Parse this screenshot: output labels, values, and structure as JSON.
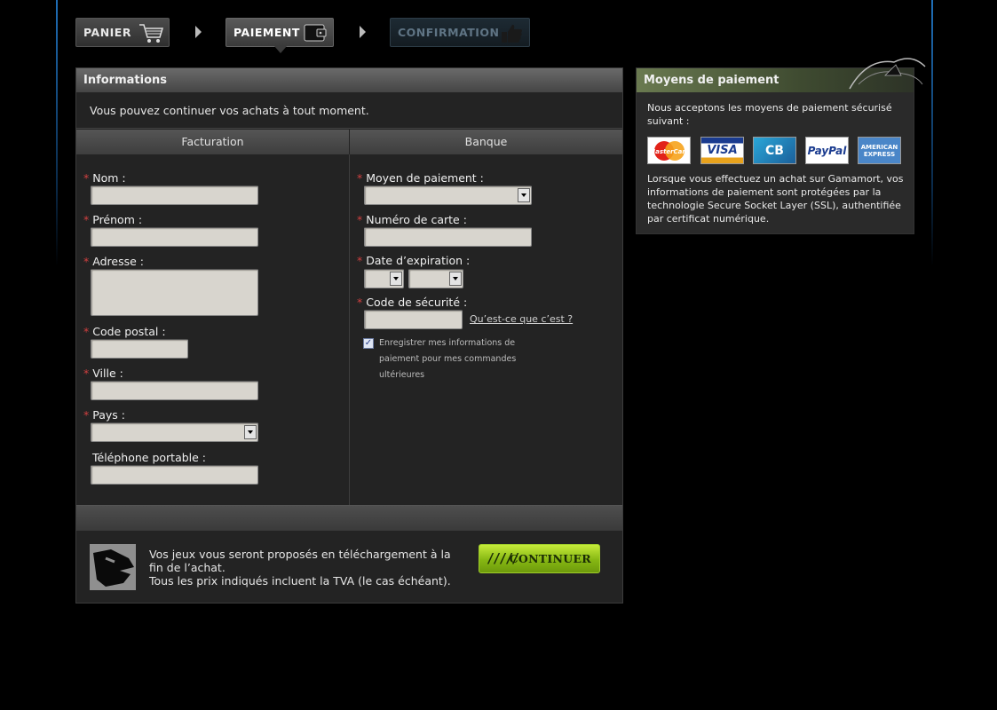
{
  "steps": [
    {
      "label": "PANIER",
      "icon": "cart-icon"
    },
    {
      "label": "PAIEMENT",
      "icon": "wallet-icon"
    },
    {
      "label": "CONFIRMATION",
      "icon": "thumbs-up-icon"
    }
  ],
  "info": {
    "title": "Informations",
    "message": "Vous pouvez continuer vos achats à tout moment."
  },
  "columns": {
    "billing": "Facturation",
    "bank": "Banque"
  },
  "billing": {
    "nom": "Nom :",
    "prenom": "Prénom :",
    "adresse": "Adresse :",
    "code_postal": "Code postal :",
    "ville": "Ville :",
    "pays": "Pays :",
    "telephone": "Téléphone portable :"
  },
  "bank": {
    "moyen": "Moyen de paiement :",
    "numero": "Numéro de carte :",
    "expiration": "Date d’expiration :",
    "securite": "Code de sécurité :",
    "help_link": "Qu’est-ce que c’est ?",
    "save_label": "Enregistrer mes informations de paiement pour mes commandes ultérieures",
    "save_checked": true
  },
  "required_mark": "*",
  "footer": {
    "line1": "Vos jeux vous seront proposés en téléchargement à la fin de l’achat.",
    "line2": "Tous les prix indiqués incluent la TVA (le cas échéant).",
    "continue": "CONTINUER"
  },
  "side": {
    "title": "Moyens de paiement",
    "accept": "Nous acceptons les moyens de paiement sécurisé suivant :",
    "cards": [
      {
        "label": "MasterCard",
        "icon": "mastercard-icon"
      },
      {
        "label": "VISA",
        "icon": "visa-icon"
      },
      {
        "label": "CB",
        "icon": "cb-icon"
      },
      {
        "label": "PayPal",
        "icon": "paypal-icon"
      },
      {
        "label": "AMERICAN EXPRESS",
        "icon": "amex-icon"
      }
    ],
    "security": "Lorsque vous effectuez un achat sur Gamamort, vos informations de paiement sont protégées par la technologie Secure Socket Layer (SSL), authentifiée par certificat numérique."
  },
  "colors": {
    "accent_green": "#86b713",
    "required_red": "#d04040",
    "blue_line": "#1f6fb8"
  }
}
